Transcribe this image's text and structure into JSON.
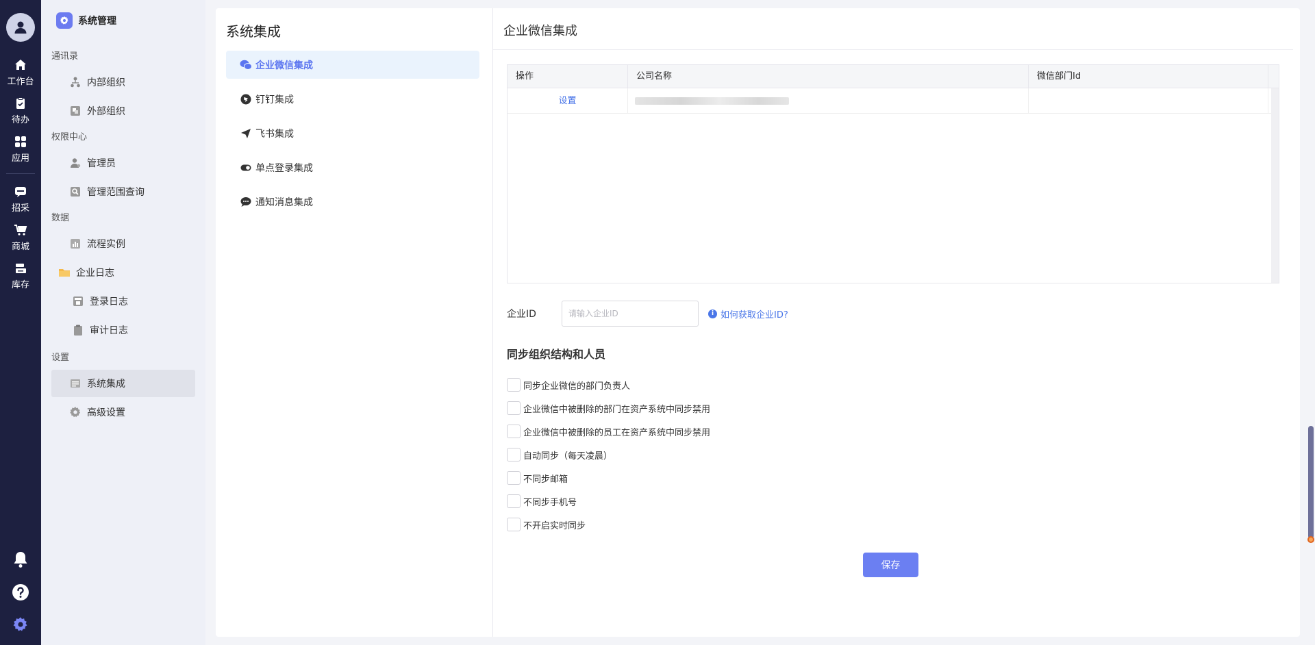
{
  "rail": {
    "items": [
      {
        "label": "工作台",
        "icon": "home-icon"
      },
      {
        "label": "待办",
        "icon": "clipboard-check-icon"
      },
      {
        "label": "应用",
        "icon": "apps-grid-icon"
      },
      {
        "label": "招采",
        "icon": "bid-chat-icon"
      },
      {
        "label": "商城",
        "icon": "cart-icon"
      },
      {
        "label": "库存",
        "icon": "inventory-icon"
      }
    ],
    "bottom_icons": [
      "bell-icon",
      "help-icon",
      "settings-gear-icon"
    ],
    "accent": "#6c7bf0"
  },
  "sidebar": {
    "title": "系统管理",
    "sections": [
      {
        "title": "通讯录",
        "items": [
          {
            "label": "内部组织",
            "icon": "org-tree-icon"
          },
          {
            "label": "外部组织",
            "icon": "external-org-icon"
          }
        ]
      },
      {
        "title": "权限中心",
        "items": [
          {
            "label": "管理员",
            "icon": "admin-user-icon"
          },
          {
            "label": "管理范围查询",
            "icon": "search-scope-icon"
          }
        ]
      },
      {
        "title": "数据",
        "items": [
          {
            "label": "流程实例",
            "icon": "chart-icon"
          },
          {
            "label": "企业日志",
            "icon": "folder-icon"
          },
          {
            "label": "登录日志",
            "icon": "login-log-icon"
          },
          {
            "label": "审计日志",
            "icon": "audit-log-icon"
          }
        ]
      },
      {
        "title": "设置",
        "items": [
          {
            "label": "系统集成",
            "icon": "integration-icon"
          },
          {
            "label": "高级设置",
            "icon": "gear-icon"
          }
        ]
      }
    ]
  },
  "integration_panel": {
    "title": "系统集成",
    "items": [
      {
        "label": "企业微信集成",
        "icon": "wechat-icon"
      },
      {
        "label": "钉钉集成",
        "icon": "dingtalk-icon"
      },
      {
        "label": "飞书集成",
        "icon": "feishu-paper-plane-icon"
      },
      {
        "label": "单点登录集成",
        "icon": "toggle-icon"
      },
      {
        "label": "通知消息集成",
        "icon": "chat-bubble-icon"
      }
    ]
  },
  "wecom": {
    "title": "企业微信集成",
    "table": {
      "headers": [
        "操作",
        "公司名称",
        "微信部门Id"
      ],
      "rows": [
        {
          "action": "设置",
          "company": "",
          "dept_id": ""
        }
      ]
    },
    "corp_id": {
      "label": "企业ID",
      "value": "",
      "placeholder": "请输入企业ID"
    },
    "help_link": "如何获取企业ID?",
    "sync_title": "同步组织结构和人员",
    "options": [
      "同步企业微信的部门负责人",
      "企业微信中被删除的部门在资产系统中同步禁用",
      "企业微信中被删除的员工在资产系统中同步禁用",
      "自动同步（每天凌晨）",
      "不同步邮箱",
      "不同步手机号",
      "不开启实时同步"
    ],
    "save_label": "保存",
    "button_color": "#6b7ff2",
    "link_color": "#4a76e8"
  }
}
